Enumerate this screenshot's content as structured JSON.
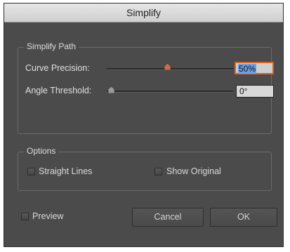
{
  "dialog": {
    "title": "Simplify",
    "simplify_path": {
      "legend": "Simplify Path",
      "curve_precision": {
        "label": "Curve Precision:",
        "value": "50%",
        "level_percent": 50
      },
      "angle_threshold": {
        "label": "Angle Threshold:",
        "value": "0°",
        "level_percent": 0
      }
    },
    "options": {
      "legend": "Options",
      "straight_lines": {
        "label": "Straight Lines",
        "checked": false
      },
      "show_original": {
        "label": "Show Original",
        "checked": false
      }
    },
    "preview": {
      "label": "Preview",
      "checked": false
    },
    "buttons": {
      "cancel": "Cancel",
      "ok": "OK"
    }
  },
  "colors": {
    "dialog_bg": "#4b4b4b",
    "active_field_border": "#e06020",
    "slider_thumb": "#c07050",
    "selection": "#6aa1e8"
  },
  "icons": [
    "slider-thumb-icon",
    "checkbox-icon"
  ]
}
